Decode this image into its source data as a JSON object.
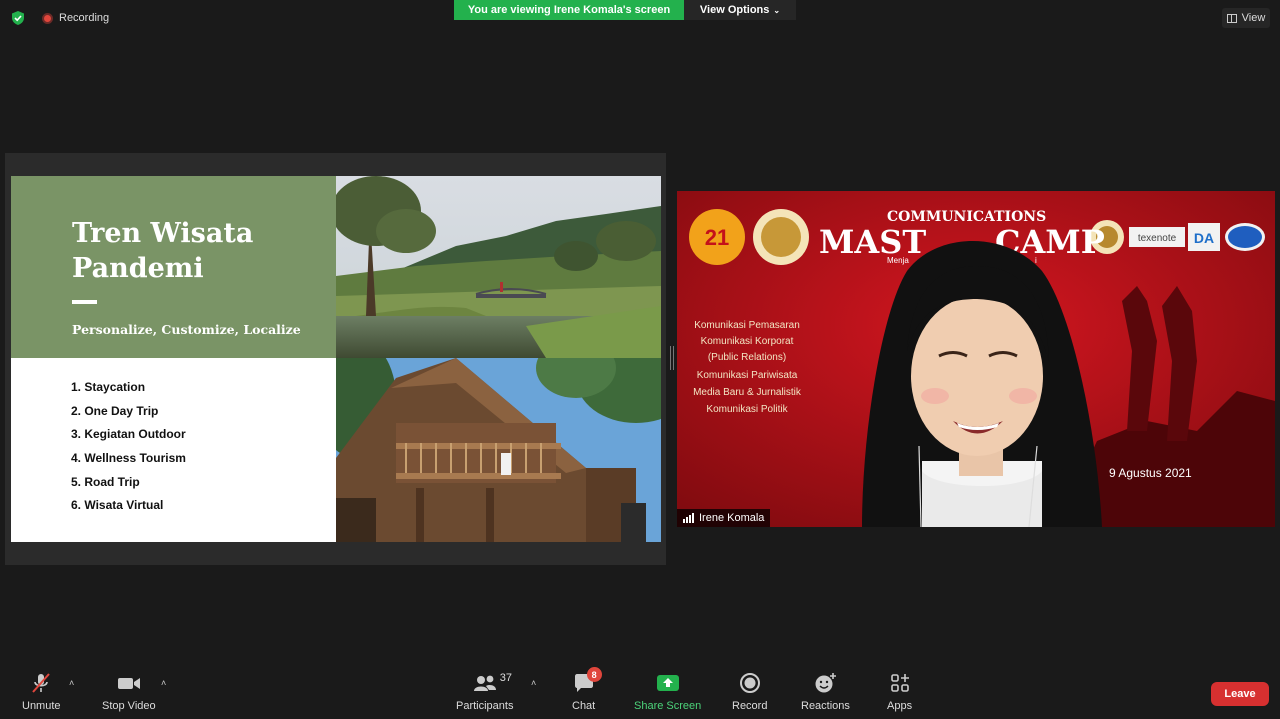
{
  "topbar": {
    "recording_label": "Recording",
    "viewing_banner": "You are viewing Irene Komala's screen",
    "view_options_label": "View Options",
    "view_button_label": "View"
  },
  "slide": {
    "title": "Tren Wisata\nPandemi",
    "subtitle": "Personalize, Customize, Localize",
    "items": [
      "1. Staycation",
      "2. One Day Trip",
      "3. Kegiatan Outdoor",
      "4. Wellness Tourism",
      "5. Road Trip",
      "6. Wisata Virtual"
    ]
  },
  "video": {
    "participant_name": "Irene Komala",
    "banner_top": "COMMUNICATIONS",
    "banner_main_left": "MAST",
    "banner_main_right": "CAMP",
    "banner_tag": "Menja",
    "banner_tag_right": "i",
    "program_lines": [
      "Komunikasi Pemasaran",
      "Komunikasi Korporat",
      "(Public Relations)",
      "Komunikasi Pariwisata",
      "Media Baru & Jurnalistik",
      "Komunikasi Politik"
    ],
    "date_text": "9 Agustus 2021",
    "logos": [
      "21",
      "texenote",
      "DA"
    ]
  },
  "toolbar": {
    "unmute_label": "Unmute",
    "stop_video_label": "Stop Video",
    "participants_label": "Participants",
    "participants_count": "37",
    "chat_label": "Chat",
    "chat_badge": "8",
    "share_screen_label": "Share Screen",
    "record_label": "Record",
    "reactions_label": "Reactions",
    "apps_label": "Apps",
    "leave_label": "Leave"
  },
  "colors": {
    "banner_green": "#23b14d",
    "slide_green": "#7a9466",
    "video_red": "#c4111a",
    "leave_red": "#d73030",
    "share_green": "#23b14d"
  }
}
